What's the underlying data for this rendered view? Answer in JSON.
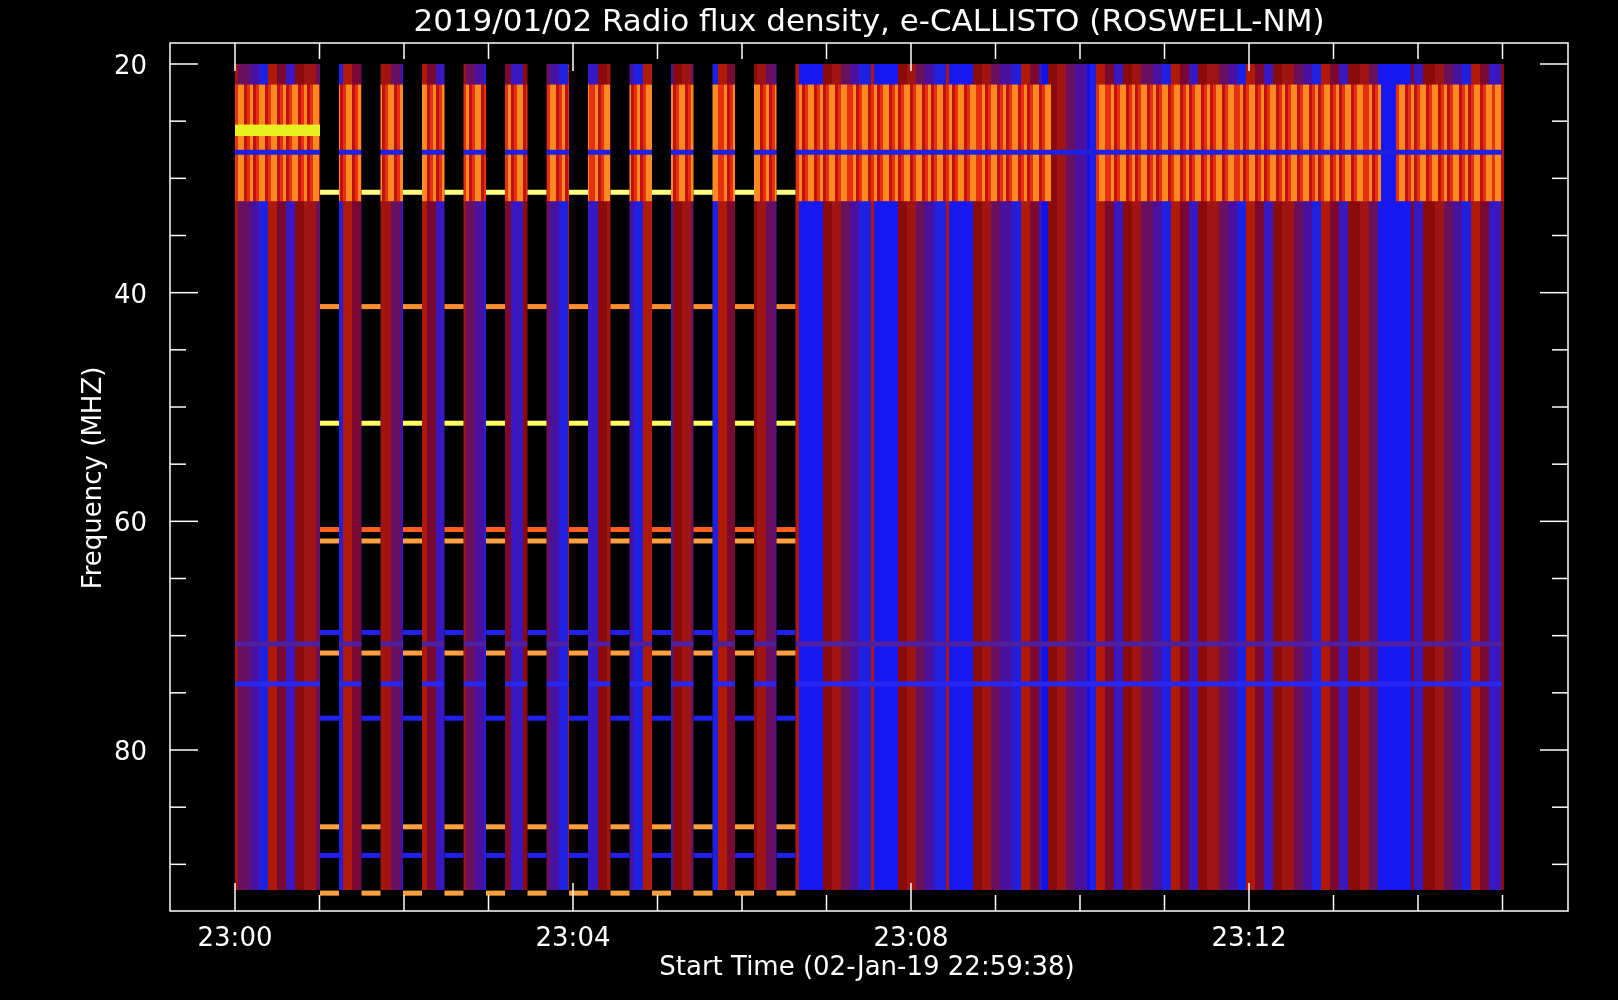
{
  "title": "2019/01/02  Radio flux density, e-CALLISTO (ROSWELL-NM)",
  "y_axis": {
    "label": "Frequency (MHZ)",
    "ticks": [
      "20",
      "40",
      "60",
      "80"
    ]
  },
  "x_axis": {
    "label": "Start Time (02-Jan-19 22:59:38)",
    "ticks": [
      "23:00",
      "23:04",
      "23:08",
      "23:12"
    ]
  }
}
